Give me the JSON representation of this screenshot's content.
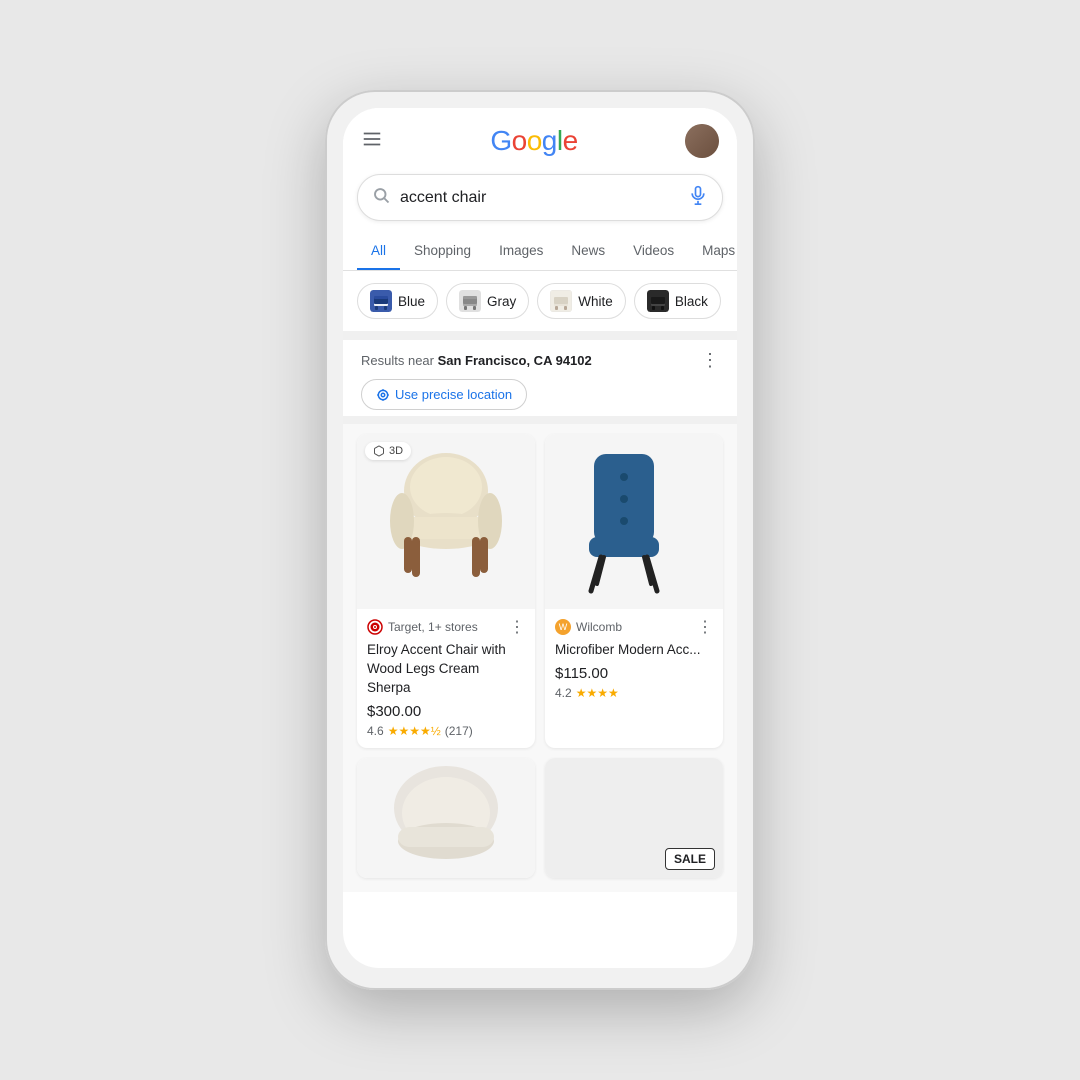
{
  "header": {
    "menu_label": "Menu",
    "logo_text": "Google",
    "logo_letters": [
      "G",
      "o",
      "o",
      "g",
      "l",
      "e"
    ],
    "logo_colors": [
      "blue",
      "red",
      "yellow",
      "blue",
      "green",
      "red"
    ],
    "avatar_alt": "User avatar"
  },
  "search": {
    "query": "accent chair",
    "placeholder": "Search",
    "mic_label": "Voice search"
  },
  "nav_tabs": [
    {
      "label": "All",
      "active": true
    },
    {
      "label": "Shopping",
      "active": false
    },
    {
      "label": "Images",
      "active": false
    },
    {
      "label": "News",
      "active": false
    },
    {
      "label": "Videos",
      "active": false
    },
    {
      "label": "Maps",
      "active": false
    }
  ],
  "filter_chips": [
    {
      "label": "Blue",
      "color": "#2D4B8E"
    },
    {
      "label": "Gray",
      "color": "#555555"
    },
    {
      "label": "White",
      "color": "#F5F0E8"
    },
    {
      "label": "Black",
      "color": "#1a1a1a"
    }
  ],
  "location": {
    "prefix": "Results near",
    "city": "San Francisco, CA 94102",
    "precise_location_btn": "Use precise location",
    "more_options": "More options"
  },
  "products": [
    {
      "id": 1,
      "badge": "3D",
      "store": "Target, 1+ stores",
      "store_type": "target",
      "title": "Elroy Accent Chair with Wood Legs Cream Sherpa",
      "price": "$300.00",
      "rating": "4.6",
      "review_count": "(217)",
      "stars": 4.6,
      "chair_color": "cream"
    },
    {
      "id": 2,
      "badge": null,
      "store": "Wilcomb",
      "store_type": "wilcomb",
      "title": "Microfiber Modern Acc...",
      "price": "$115.00",
      "rating": "4.2",
      "review_count": "",
      "stars": 4.2,
      "chair_color": "blue"
    }
  ],
  "bottom_product": {
    "sale_badge": "SALE",
    "chair_color": "white-round"
  }
}
